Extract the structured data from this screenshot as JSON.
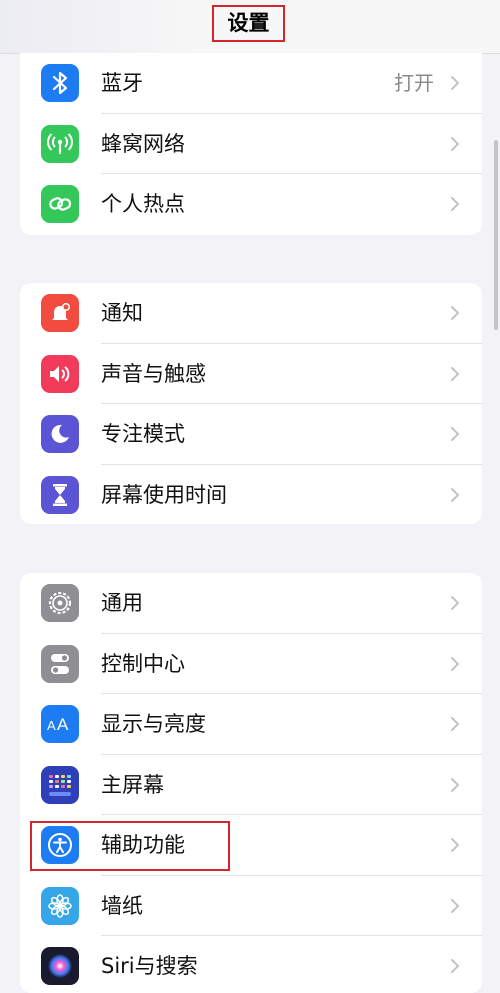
{
  "nav": {
    "title": "设置"
  },
  "groups": [
    {
      "items": [
        {
          "label": "蓝牙",
          "value": "打开",
          "icon": "bluetooth-icon",
          "color": "#1d7cf2"
        },
        {
          "label": "蜂窝网络",
          "icon": "cellular-antenna-icon",
          "color": "#34c759"
        },
        {
          "label": "个人热点",
          "icon": "personal-hotspot-icon",
          "color": "#34c759"
        }
      ]
    },
    {
      "items": [
        {
          "label": "通知",
          "icon": "notification-bell-icon",
          "color": "#f24b3f"
        },
        {
          "label": "声音与触感",
          "icon": "speaker-icon",
          "color": "#f23b5a"
        },
        {
          "label": "专注模式",
          "icon": "moon-icon",
          "color": "#5b55d6"
        },
        {
          "label": "屏幕使用时间",
          "icon": "hourglass-icon",
          "color": "#5b55d6"
        }
      ]
    },
    {
      "items": [
        {
          "label": "通用",
          "icon": "gear-icon",
          "color": "#8e8e93"
        },
        {
          "label": "控制中心",
          "icon": "toggle-switches-icon",
          "color": "#8e8e93"
        },
        {
          "label": "显示与亮度",
          "icon": "text-size-aa-icon",
          "color": "#1d7cf2"
        },
        {
          "label": "主屏幕",
          "icon": "home-screen-grid-icon",
          "color": "#2f3fb8"
        },
        {
          "label": "辅助功能",
          "icon": "accessibility-person-icon",
          "color": "#1d7cf2"
        },
        {
          "label": "墙纸",
          "icon": "wallpaper-flower-icon",
          "color": "#35a7e8"
        },
        {
          "label": "Siri与搜索",
          "icon": "siri-orb-icon",
          "color": "#1a1a2e"
        }
      ]
    }
  ]
}
